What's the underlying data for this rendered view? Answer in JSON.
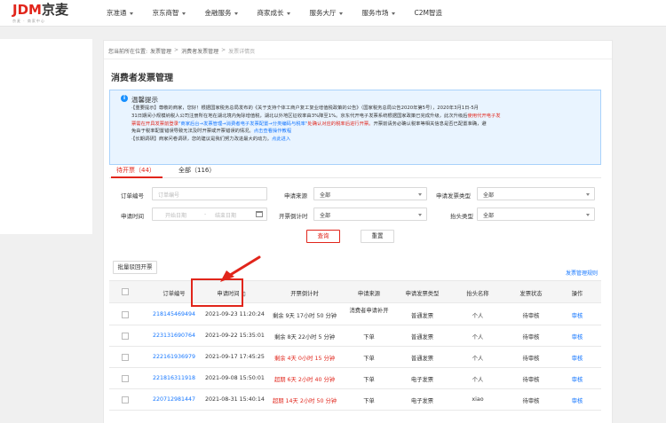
{
  "header": {
    "logo_main": "JDM",
    "logo_cn": "京麦",
    "logo_sub": "京麦 · 商家中心",
    "nav": [
      "京准通",
      "京东商智",
      "金融服务",
      "商家成长",
      "服务大厅",
      "服务市场",
      "C2M智造"
    ]
  },
  "breadcrumb": {
    "prefix": "您当前所在位置:",
    "items": [
      "发票管理",
      "消费者发票管理",
      "发票详情页"
    ]
  },
  "page_title": "消费者发票管理",
  "notice": {
    "title": "温馨提示",
    "line1a": "·【重要提示】尊敬的商家，您好！根据国家税务总局发布的《关于支持个体工商户复工复业增值税政策的公告》（国家税务总局公告2020年第5号），2020年3月1日-5月",
    "line2a": "31日期间小规模纳税人公司注册所在地在湖北境内免除增值税，湖北以外地区征收率由3%降至1%。京东代开电子发票系统根据国家政策已完成升级，此次升级后",
    "line2red": "使用代开电子发",
    "line3red": "票需在开具发票前登录",
    "line3blue": "\"商家后台→发票管理→消费者电子发票配置→分类编码与税率\"",
    "line3red2": "处确认对应的税率后进行开票。",
    "line3b": "开票前请务必确认税率等相关信息是否已配置准确，避",
    "line4a": "免由于税率配置错误导致无法及时开票或开票错误的情况。",
    "line4blue": "点击查看操作教程",
    "line5a": "·【长期调研】商家问卷调研，您的建议是我们努力改进最大的动力。",
    "line5blue": "点此进入"
  },
  "tabs": [
    {
      "label": "待开票（44）",
      "active": true
    },
    {
      "label": "全部（116）",
      "active": false
    }
  ],
  "filters": {
    "order_no_label": "订单编号",
    "order_no_placeholder": "订单编号",
    "apply_source_label": "申请来源",
    "apply_source_value": "全部",
    "invoice_type_label": "申请发票类型",
    "invoice_type_value": "全部",
    "apply_time_label": "申请时间",
    "start_placeholder": "开始日期",
    "date_separator": "-",
    "end_placeholder": "结束日期",
    "countdown_label": "开票倒计时",
    "countdown_value": "全部",
    "title_type_label": "抬头类型",
    "title_type_value": "全部"
  },
  "buttons": {
    "query": "查询",
    "reset": "重置",
    "batch_reject": "批量驳回开票",
    "rules_link": "发票管理规则"
  },
  "table": {
    "columns": [
      "订单编号",
      "申请时间",
      "开票倒计时",
      "申请来源",
      "申请发票类型",
      "抬头名称",
      "发票状态",
      "操作"
    ],
    "rows": [
      {
        "order": "218145469494",
        "time": "2021-09-23 11:20:24",
        "countdown": "剩余 9天 17小时 50 分钟",
        "countdown_red": false,
        "source": "消费者申请补开",
        "type": "普通发票",
        "title": "个人",
        "status": "待审核",
        "action": "审核"
      },
      {
        "order": "223131690764",
        "time": "2021-09-22 15:35:01",
        "countdown": "剩余 8天 22小时 5 分钟",
        "countdown_red": false,
        "source": "下单",
        "type": "普通发票",
        "title": "个人",
        "status": "待审核",
        "action": "审核"
      },
      {
        "order": "222161936979",
        "time": "2021-09-17 17:45:25",
        "countdown": "剩余 4天 0小时 15 分钟",
        "countdown_red": true,
        "source": "下单",
        "type": "普通发票",
        "title": "个人",
        "status": "待审核",
        "action": "审核"
      },
      {
        "order": "221816311918",
        "time": "2021-09-08 15:50:01",
        "countdown": "超期 6天 2小时 40 分钟",
        "countdown_red": true,
        "source": "下单",
        "type": "电子发票",
        "title": "个人",
        "status": "待审核",
        "action": "审核"
      },
      {
        "order": "220712981447",
        "time": "2021-08-31 15:40:14",
        "countdown": "超期 14天 2小时 50 分钟",
        "countdown_red": true,
        "source": "下单",
        "type": "电子发票",
        "title": "xiao",
        "status": "待审核",
        "action": "审核"
      }
    ]
  },
  "colors": {
    "brand_red": "#e1251b",
    "link_blue": "#1677ff",
    "notice_bg": "#e9f4ff"
  }
}
